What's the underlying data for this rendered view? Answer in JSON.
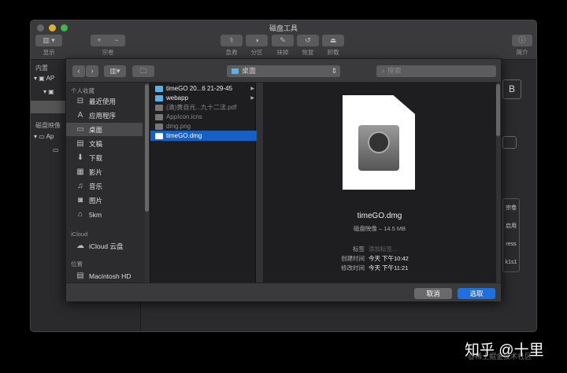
{
  "window": {
    "title": "磁盘工具"
  },
  "toolbar": {
    "display": "显示",
    "volume": "宗卷",
    "first_aid": "急救",
    "partition": "分区",
    "erase": "抹掉",
    "restore": "恢复",
    "unmount": "卸载",
    "info": "简介"
  },
  "disk_sidebar": {
    "internal": "内置",
    "item1": "AP",
    "item2": "Ap",
    "disk_images": "磁盘映像"
  },
  "dialog": {
    "location": "桌面",
    "search_placeholder": "搜索",
    "sidebar": {
      "favorites": "个人收藏",
      "items": [
        {
          "label": "最近使用",
          "icon": "clock-icon"
        },
        {
          "label": "应用程序",
          "icon": "applications-icon"
        },
        {
          "label": "桌面",
          "icon": "desktop-icon"
        },
        {
          "label": "文稿",
          "icon": "document-icon"
        },
        {
          "label": "下载",
          "icon": "download-icon"
        },
        {
          "label": "影片",
          "icon": "film-icon"
        },
        {
          "label": "音乐",
          "icon": "music-icon"
        },
        {
          "label": "图片",
          "icon": "camera-icon"
        },
        {
          "label": "5km",
          "icon": "home-icon"
        }
      ],
      "icloud": "iCloud",
      "icloud_drive": "iCloud 云盘",
      "locations": "位置",
      "macintosh": "Macintosh HD"
    },
    "files": [
      {
        "name": "timeGO 20...6 21-29-45",
        "folder": true
      },
      {
        "name": "webapp",
        "folder": true
      },
      {
        "name": "(清)黄自元...九十二法.pdf"
      },
      {
        "name": "AppIcon.icns"
      },
      {
        "name": "dmg.png"
      },
      {
        "name": "timeGO.dmg",
        "selected": true
      }
    ],
    "preview": {
      "name": "timeGO.dmg",
      "kind": "磁盘映像 – 14.5 MB",
      "tags_label": "标签",
      "tags_placeholder": "添加标签...",
      "created_label": "创建时间",
      "created": "今天 下午10:42",
      "modified_label": "修改时间",
      "modified": "今天 下午11:21"
    },
    "cancel": "取消",
    "choose": "选取"
  },
  "background_right": {
    "b": "B",
    "volume": "宗卷",
    "enabled": "启用",
    "ress": "ress",
    "k1s1": "k1s1"
  },
  "watermark": {
    "main": "知乎 @十里",
    "sub": "@稀土掘金技术社区"
  },
  "colors": {
    "accent": "#1560c4"
  }
}
